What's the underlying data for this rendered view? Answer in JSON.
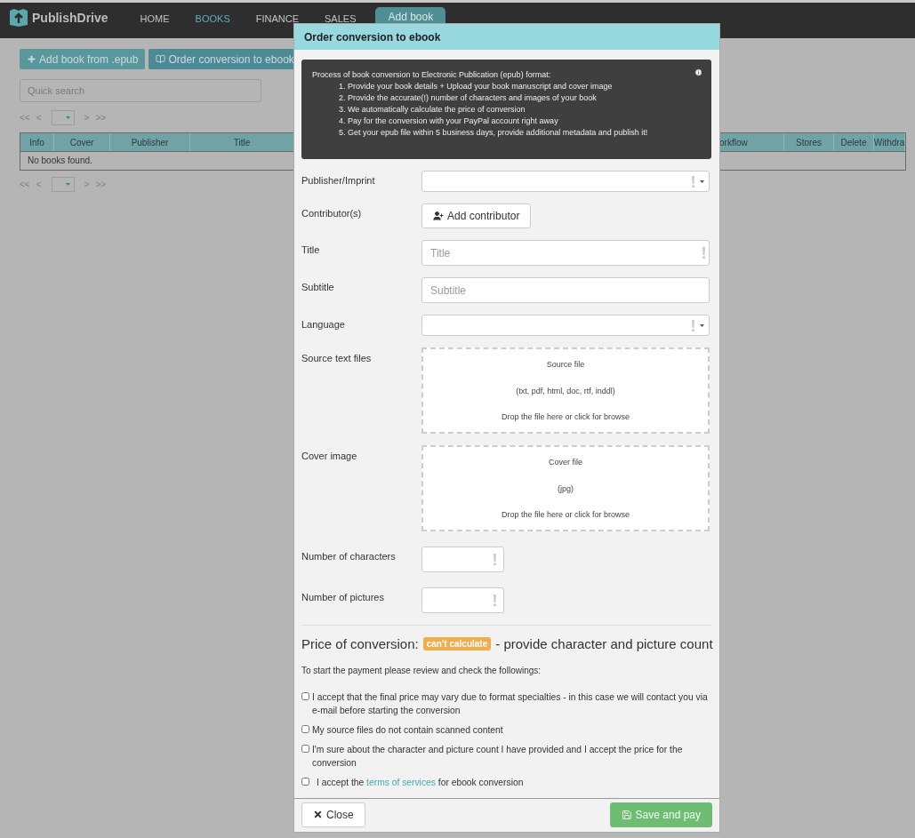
{
  "navbar": {
    "logo": "PublishDrive",
    "items": [
      {
        "label": "HOME",
        "selected": false
      },
      {
        "label": "BOOKS",
        "selected": true
      },
      {
        "label": "FINANCE",
        "selected": false
      },
      {
        "label": "SALES",
        "selected": false
      }
    ],
    "add_book": "Add book"
  },
  "toolbar": {
    "buttons": [
      {
        "label": "Add book from .epub",
        "kind": "add"
      },
      {
        "label": "Order conversion to ebook",
        "kind": "book"
      }
    ]
  },
  "search": {
    "placeholder": "Quick search"
  },
  "pagers": [
    {
      "first": "<<",
      "prev": "<",
      "next": ">",
      "last": ">>"
    },
    {
      "first": "<<",
      "prev": "<",
      "next": ">",
      "last": ">>"
    }
  ],
  "table": {
    "columns": [
      "Info",
      "Cover",
      "Publisher",
      "Title",
      "orkflow",
      "Stores",
      "Delete",
      "Withdra"
    ],
    "empty_message": "No books found."
  },
  "dialog": {
    "title": "Order conversion to ebook",
    "info": {
      "heading": "Process of book conversion to Electronic Publication (epub) format:",
      "steps": [
        "1. Provide your book details + Upload your book manuscript and cover image",
        "2. Provide the accurate(!) number of characters and images of your book",
        "3. We automatically calculate the price of conversion",
        "4. Pay for the conversion with your PayPal account right away",
        "5. Get your epub file within 5 business days, provide additional metadata and publish it!"
      ]
    },
    "fields": [
      {
        "kind": "select",
        "label": "Publisher/Imprint",
        "required": true
      },
      {
        "kind": "button",
        "label": "Contributor(s)",
        "button": "Add contributor"
      },
      {
        "kind": "text",
        "label": "Title",
        "placeholder": "Title",
        "required": true
      },
      {
        "kind": "text",
        "label": "Subtitle",
        "placeholder": "Subtitle",
        "required": false
      },
      {
        "kind": "select",
        "label": "Language",
        "required": true
      },
      {
        "kind": "drop",
        "label": "Source text files",
        "title": "Source file",
        "formats": "(txt, pdf, html, doc, rtf, inddl)",
        "hint": "Drop the file here or click for browse"
      },
      {
        "kind": "drop",
        "label": "Cover image",
        "title": "Cover file",
        "formats": "(jpg)",
        "hint": "Drop the file here or click for browse"
      },
      {
        "kind": "number",
        "label": "Number of characters",
        "required": true
      },
      {
        "kind": "number",
        "label": "Number of pictures",
        "required": true
      }
    ],
    "price": {
      "label": "Price of conversion:",
      "badge": "can't calculate",
      "note": "- provide character and picture count"
    },
    "intro": "To start the payment please review and check the followings:",
    "checks": [
      {
        "kind": "plain",
        "text": "I accept that the final price may vary due to format specialties - in this case we will contact you via e-mail before starting the conversion",
        "checked": false
      },
      {
        "kind": "plain",
        "text": "My source files do not contain scanned content",
        "checked": false
      },
      {
        "kind": "plain",
        "text": "I'm sure about the character and picture count I have provided and I accept the price for the conversion",
        "checked": false
      },
      {
        "kind": "link",
        "before": "I accept the",
        "link": "terms of services",
        "after": "for ebook conversion",
        "checked": false
      }
    ],
    "close": "Close",
    "save": "Save and pay"
  }
}
